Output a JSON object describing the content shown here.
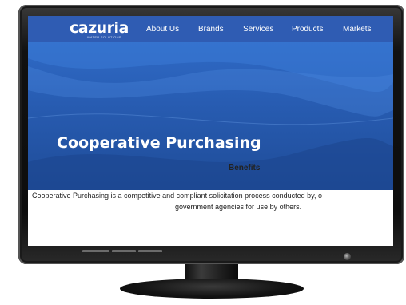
{
  "brand": {
    "name": "cazuria",
    "tagline": "WATER SOLUTIONS"
  },
  "nav": {
    "items": [
      {
        "label": "About Us"
      },
      {
        "label": "Brands"
      },
      {
        "label": "Services"
      },
      {
        "label": "Products"
      },
      {
        "label": "Markets"
      }
    ]
  },
  "hero": {
    "title": "Cooperative Purchasing"
  },
  "content": {
    "heading": "Benefits",
    "paragraph_line1": "Cooperative Purchasing is a competitive and compliant solicitation process conducted by, o",
    "paragraph_line2": "government agencies for use by others."
  },
  "colors": {
    "nav_bg": "#2f5cb3",
    "hero_bg": "#275bb0",
    "bezel": "#0d0d0d"
  }
}
